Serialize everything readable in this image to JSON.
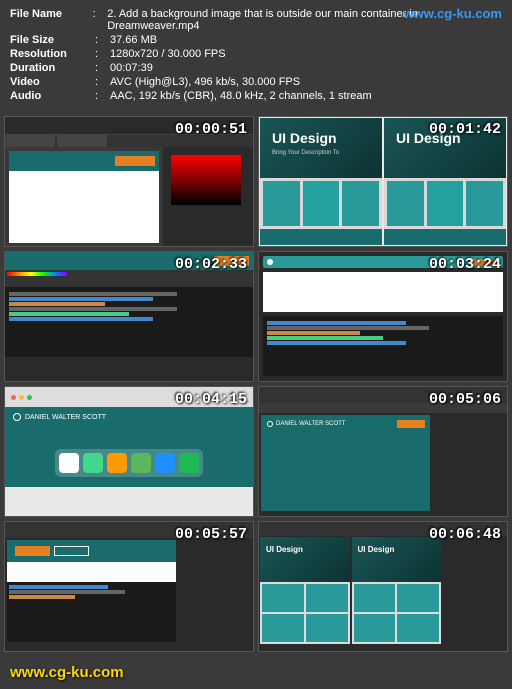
{
  "meta": {
    "filename_label": "File Name",
    "filename_value": "2. Add a background image that is outside our main container in Dreamweaver.mp4",
    "filesize_label": "File Size",
    "filesize_value": "37.66 MB",
    "resolution_label": "Resolution",
    "resolution_value": "1280x720 / 30.000 FPS",
    "duration_label": "Duration",
    "duration_value": "00:07:39",
    "video_label": "Video",
    "video_value": "AVC (High@L3), 496 kb/s, 30.000 FPS",
    "audio_label": "Audio",
    "audio_value": "AAC, 192 kb/s (CBR), 48.0 kHz, 2 channels, 1 stream"
  },
  "timestamps": {
    "t1": "00:00:51",
    "t2": "00:01:42",
    "t3": "00:02:33",
    "t4": "00:03:24",
    "t5": "00:04:15",
    "t6": "00:05:06",
    "t7": "00:05:57",
    "t8": "00:06:48"
  },
  "ui_text": {
    "ui_design": "UI Design",
    "subtitle": "Bring Your Description To",
    "logo_label": "DANIEL WALTER SCOTT"
  },
  "watermark": "www.cg-ku.com",
  "watermark_top": "www.cg-ku.com",
  "colors": {
    "teal": "#1a6b6b",
    "orange": "#e67e22",
    "chrome": "#4285f4",
    "dw_green": "#41d88c",
    "ai_orange": "#ff9a00",
    "camtasia": "#5cb85c",
    "finder": "#1e90ff",
    "spotify": "#1db954"
  }
}
